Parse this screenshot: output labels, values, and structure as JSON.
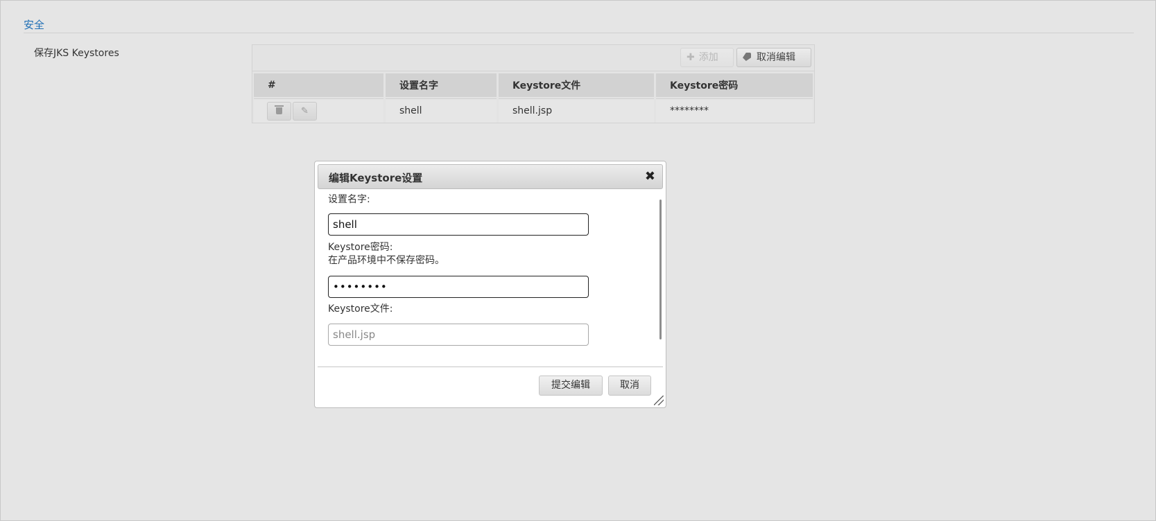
{
  "section": {
    "title": "安全"
  },
  "keystores_row": {
    "label": "保存JKS Keystores"
  },
  "table": {
    "toolbar": {
      "add_label": "添加",
      "cancel_edit_label": "取消编辑"
    },
    "columns": [
      "#",
      "设置名字",
      "Keystore文件",
      "Keystore密码"
    ],
    "rows": [
      {
        "name": "shell",
        "file": "shell.jsp",
        "password": "********"
      }
    ]
  },
  "dialog": {
    "title": "编辑Keystore设置",
    "fields": {
      "name_label": "设置名字:",
      "name_value": "shell",
      "password_label": "Keystore密码:",
      "password_hint": "在产品环境中不保存密码。",
      "password_value": "••••••••",
      "file_label": "Keystore文件:",
      "file_value": "shell.jsp"
    },
    "buttons": {
      "submit": "提交编辑",
      "cancel": "取消"
    }
  },
  "icons": {
    "add": "plus-icon",
    "cancel_edit": "tag-icon",
    "delete": "trash-icon",
    "edit": "pencil-icon",
    "close": "close-icon",
    "resize": "resize-grip-icon"
  },
  "colors": {
    "page_bg": "#e5e5e5",
    "section_title": "#1f6fb5",
    "dialog_bg": "#ffffff"
  }
}
